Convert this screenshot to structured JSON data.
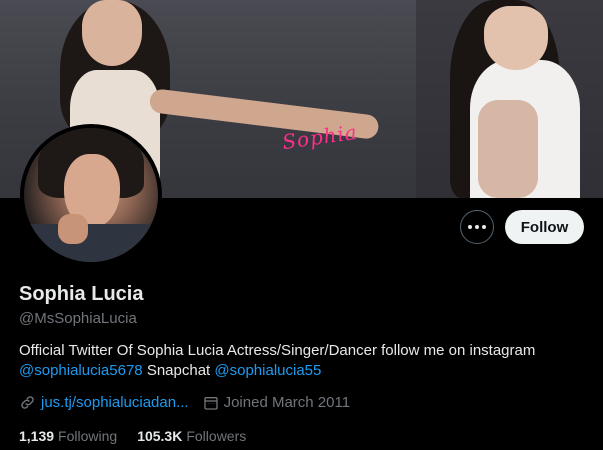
{
  "banner": {
    "signature_text": "Sophia"
  },
  "actions": {
    "more_icon": "more-horizontal-icon",
    "follow_label": "Follow"
  },
  "profile": {
    "display_name": "Sophia Lucia",
    "handle": "@MsSophiaLucia",
    "bio": {
      "text_1": "Official Twitter Of Sophia Lucia Actress/Singer/Dancer follow me on instagram",
      "mention_1": "@sophialucia5678",
      "text_2": "Snapchat",
      "mention_2": "@sophialucia55"
    },
    "website": "jus.tj/sophialuciadan...",
    "joined": "Joined March 2011",
    "following_count": "1,139",
    "following_label": "Following",
    "followers_count": "105.3K",
    "followers_label": "Followers"
  },
  "colors": {
    "background": "#000000",
    "text_primary": "#e7e9ea",
    "text_secondary": "#71767b",
    "accent_link": "#1d9bf0",
    "follow_button_bg": "#eff3f4",
    "signature_pink": "#ff2e8a"
  }
}
